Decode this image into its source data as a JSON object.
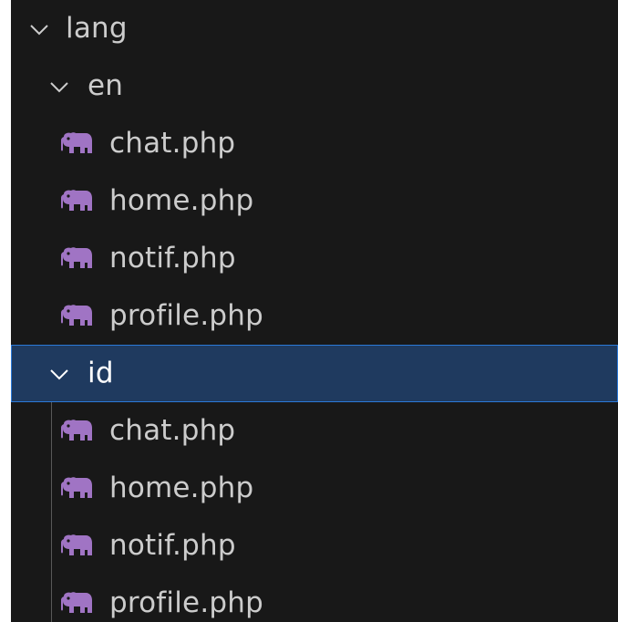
{
  "explorer": {
    "root": {
      "label": "lang",
      "expanded": true,
      "icon": "chevron-down-icon"
    },
    "folders": [
      {
        "label": "en",
        "expanded": true,
        "selected": false,
        "icon": "chevron-down-icon",
        "files": [
          {
            "label": "chat.php",
            "icon": "php-elephant-icon"
          },
          {
            "label": "home.php",
            "icon": "php-elephant-icon"
          },
          {
            "label": "notif.php",
            "icon": "php-elephant-icon"
          },
          {
            "label": "profile.php",
            "icon": "php-elephant-icon"
          }
        ]
      },
      {
        "label": "id",
        "expanded": true,
        "selected": true,
        "icon": "chevron-down-icon",
        "files": [
          {
            "label": "chat.php",
            "icon": "php-elephant-icon"
          },
          {
            "label": "home.php",
            "icon": "php-elephant-icon"
          },
          {
            "label": "notif.php",
            "icon": "php-elephant-icon"
          },
          {
            "label": "profile.php",
            "icon": "php-elephant-icon"
          }
        ]
      }
    ]
  },
  "colors": {
    "background": "#181818",
    "text": "#cccccc",
    "selection_background": "#1f3a5f",
    "selection_border": "#2b79d8",
    "php_icon": "#a074c4",
    "indent_guide": "#585858"
  }
}
